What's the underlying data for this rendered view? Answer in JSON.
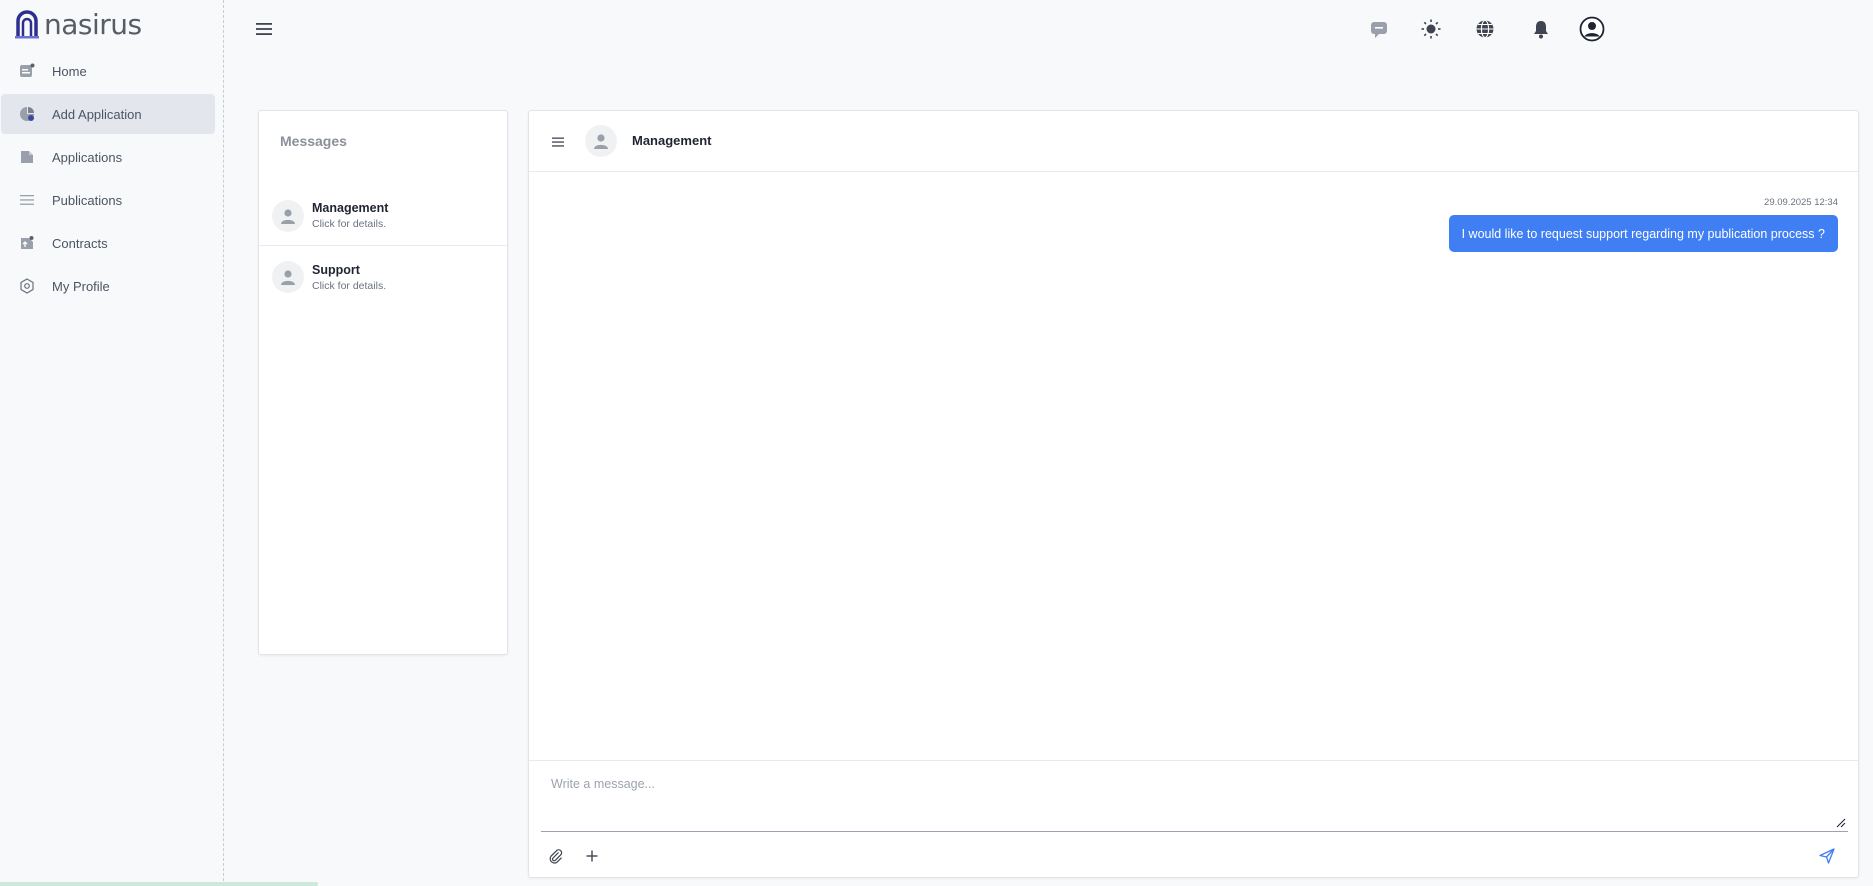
{
  "brand": {
    "name": "nasirus",
    "color": "#2d2f8f"
  },
  "sidebar": {
    "items": [
      {
        "label": "Home",
        "icon": "home-icon",
        "active": false
      },
      {
        "label": "Add Application",
        "icon": "add-application-icon",
        "active": true
      },
      {
        "label": "Applications",
        "icon": "document-icon",
        "active": false
      },
      {
        "label": "Publications",
        "icon": "list-icon",
        "active": false
      },
      {
        "label": "Contracts",
        "icon": "contract-icon",
        "active": false
      },
      {
        "label": "My Profile",
        "icon": "profile-gear-icon",
        "active": false
      }
    ]
  },
  "topbar": {
    "icons": [
      "menu-icon",
      "chat-bubble-icon",
      "theme-sun-icon",
      "language-globe-icon",
      "notification-bell-icon",
      "user-account-icon"
    ]
  },
  "messages": {
    "title": "Messages",
    "contacts": [
      {
        "name": "Management",
        "subtitle": "Click for details."
      },
      {
        "name": "Support",
        "subtitle": "Click for details."
      }
    ]
  },
  "chat": {
    "contact_name": "Management",
    "messages": [
      {
        "timestamp": "29.09.2025 12:34",
        "text": "I would like to request support regarding my publication process ?"
      }
    ],
    "input": {
      "placeholder": "Write a message...",
      "value": ""
    },
    "bubble_color": "#3f7ef3"
  },
  "progress": {
    "fraction": 0.17
  }
}
